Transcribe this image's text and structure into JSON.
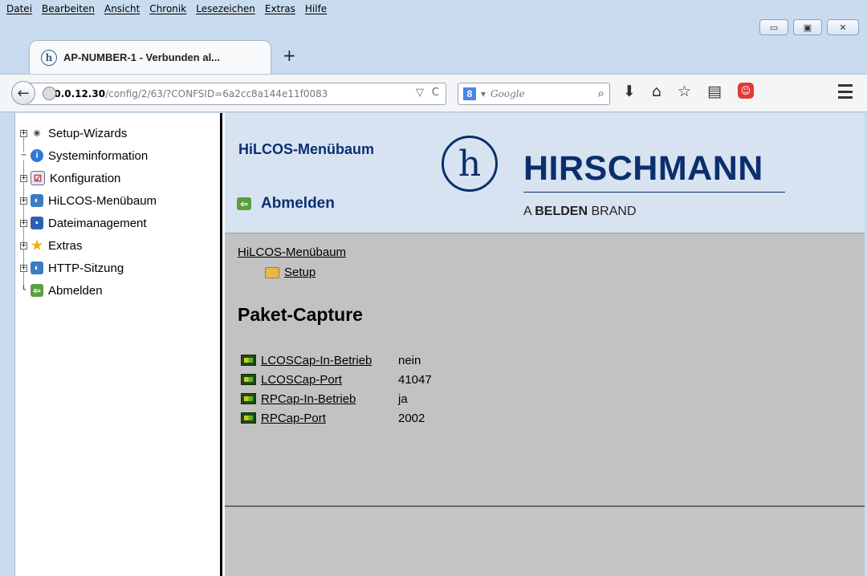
{
  "menubar": [
    "Datei",
    "Bearbeiten",
    "Ansicht",
    "Chronik",
    "Lesezeichen",
    "Extras",
    "Hilfe"
  ],
  "tab": {
    "title": "AP-NUMBER-1 - Verbunden al...",
    "new_tab": "+"
  },
  "url": {
    "domain": "10.0.12.30",
    "path": "/config/2/63/?CONFSID=6a2cc8a144e11f0083"
  },
  "search": {
    "placeholder": "Google",
    "engine_badge": "8"
  },
  "tree": [
    {
      "label": "Setup-Wizards",
      "icon": "wizard-icon",
      "expandable": true
    },
    {
      "label": "Systeminformation",
      "icon": "info-icon",
      "expandable": false
    },
    {
      "label": "Konfiguration",
      "icon": "config-icon",
      "expandable": true
    },
    {
      "label": "HiLCOS-Menübaum",
      "icon": "network-icon",
      "expandable": true
    },
    {
      "label": "Dateimanagement",
      "icon": "save-icon",
      "expandable": true
    },
    {
      "label": "Extras",
      "icon": "star-icon",
      "expandable": true
    },
    {
      "label": "HTTP-Sitzung",
      "icon": "network-icon",
      "expandable": true
    },
    {
      "label": "Abmelden",
      "icon": "logout-icon",
      "expandable": false
    }
  ],
  "header": {
    "title": "HiLCOS-Menübaum",
    "logout": "Abmelden",
    "brand": "HIRSCHMANN",
    "brand_prefix": "A",
    "brand_bold": "BELDEN",
    "brand_suffix": "BRAND",
    "logo_glyph": "h"
  },
  "breadcrumb": {
    "root": "HiLCOS-Menübaum",
    "child": "Setup"
  },
  "page": {
    "heading": "Paket-Capture"
  },
  "params": [
    {
      "name": "LCOSCap-In-Betrieb",
      "value": "nein"
    },
    {
      "name": "LCOSCap-Port",
      "value": "41047"
    },
    {
      "name": "RPCap-In-Betrieb",
      "value": "ja"
    },
    {
      "name": "RPCap-Port",
      "value": "2002"
    }
  ],
  "colors": {
    "brand": "#0b2f6d",
    "header_bg": "#d8e3f1",
    "content_bg": "#c2c2c2"
  }
}
